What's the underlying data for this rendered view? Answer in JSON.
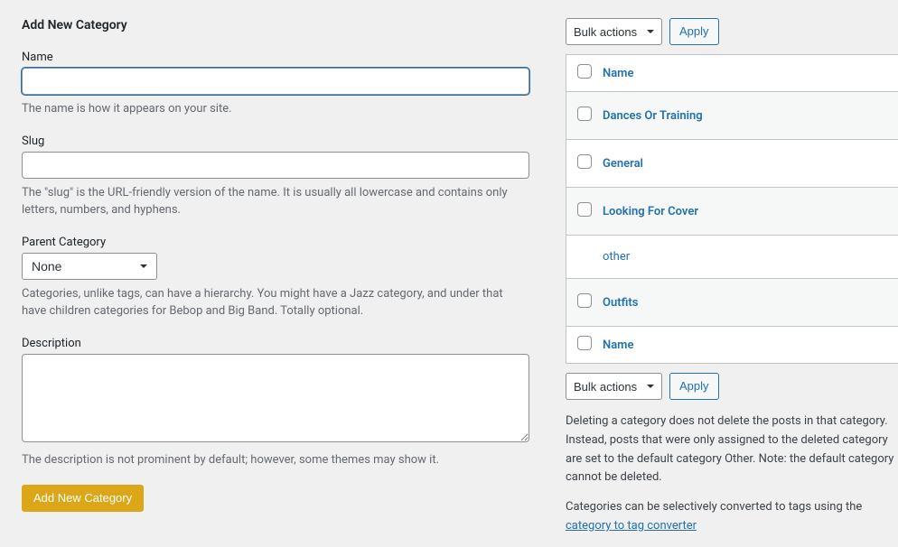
{
  "form": {
    "heading": "Add New Category",
    "name": {
      "label": "Name",
      "value": "",
      "desc": "The name is how it appears on your site."
    },
    "slug": {
      "label": "Slug",
      "value": "",
      "desc": "The \"slug\" is the URL-friendly version of the name. It is usually all lowercase and contains only letters, numbers, and hyphens."
    },
    "parent": {
      "label": "Parent Category",
      "selected": "None",
      "desc": "Categories, unlike tags, can have a hierarchy. You might have a Jazz category, and under that have children categories for Bebop and Big Band. Totally optional."
    },
    "description": {
      "label": "Description",
      "value": "",
      "desc": "The description is not prominent by default; however, some themes may show it."
    },
    "submit_label": "Add New Category"
  },
  "list": {
    "bulk_label": "Bulk actions",
    "apply_label": "Apply",
    "column_name": "Name",
    "rows": [
      {
        "title": "Dances Or Training"
      },
      {
        "title": "General"
      },
      {
        "title": "Looking For Cover"
      },
      {
        "title": "other"
      },
      {
        "title": "Outfits"
      }
    ],
    "note1": "Deleting a category does not delete the posts in that category. Instead, posts that were only assigned to the deleted category are set to the default category Other. Note: the default category cannot be deleted.",
    "note2_prefix": "Categories can be selectively converted to tags using the ",
    "note2_link": "category to tag converter"
  }
}
